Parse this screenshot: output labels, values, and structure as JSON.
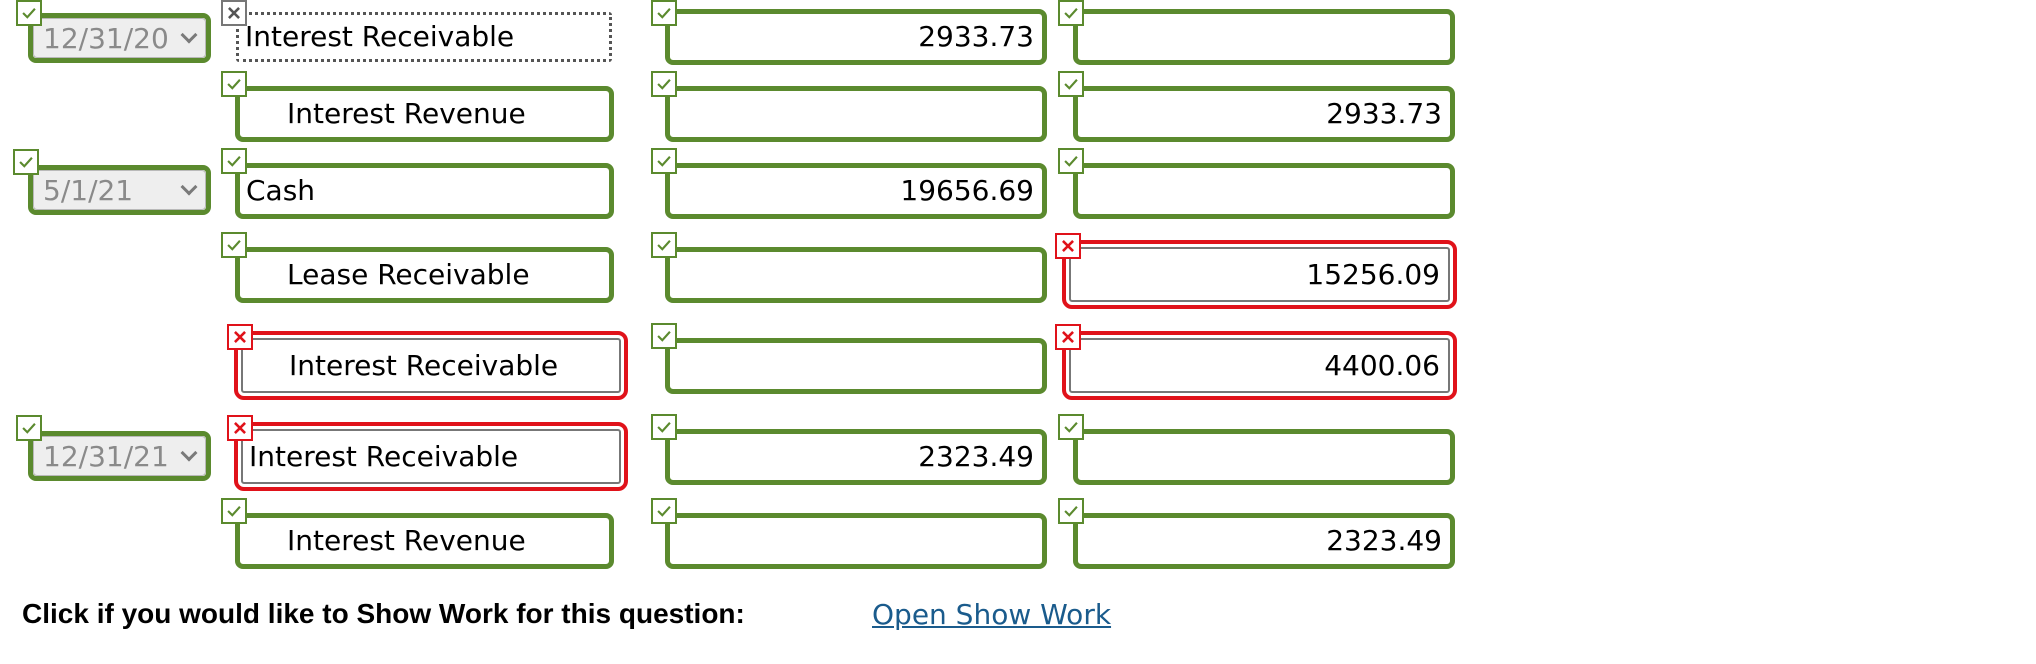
{
  "colors": {
    "correct_border": "#5b8a2e",
    "incorrect_border": "#e0121a",
    "link": "#1a5b8c"
  },
  "journal": {
    "rows": [
      {
        "date": "12/31/20",
        "account": "Interest Receivable",
        "debit": "2933.73",
        "credit": ""
      },
      {
        "date": "",
        "account": "Interest Revenue",
        "debit": "",
        "credit": "2933.73"
      },
      {
        "date": "5/1/21",
        "account": "Cash",
        "debit": "19656.69",
        "credit": ""
      },
      {
        "date": "",
        "account": "Lease Receivable",
        "debit": "",
        "credit": "15256.09"
      },
      {
        "date": "",
        "account": "Interest Receivable",
        "debit": "",
        "credit": "4400.06"
      },
      {
        "date": "12/31/21",
        "account": "Interest Receivable",
        "debit": "2323.49",
        "credit": ""
      },
      {
        "date": "",
        "account": "Interest Revenue",
        "debit": "",
        "credit": "2323.49"
      }
    ],
    "marks": {
      "row0": {
        "date": "correct",
        "account": "neutral",
        "debit": "correct",
        "credit": "correct"
      },
      "row1": {
        "account": "correct",
        "debit": "correct",
        "credit": "correct"
      },
      "row2": {
        "date": "correct",
        "account": "correct",
        "debit": "correct",
        "credit": "correct"
      },
      "row3": {
        "account": "correct",
        "debit": "correct",
        "credit": "incorrect"
      },
      "row4": {
        "account": "incorrect",
        "debit": "correct",
        "credit": "incorrect"
      },
      "row5": {
        "date": "correct",
        "account": "incorrect",
        "debit": "correct",
        "credit": "correct"
      },
      "row6": {
        "account": "correct",
        "debit": "correct",
        "credit": "correct"
      }
    }
  },
  "footer": {
    "prompt": "Click if you would like to Show Work for this question:",
    "link_label": "Open Show Work"
  },
  "icons": {
    "correct": "check-icon",
    "incorrect": "x-icon",
    "neutral": "x-icon",
    "dropdown": "chevron-down-icon"
  }
}
